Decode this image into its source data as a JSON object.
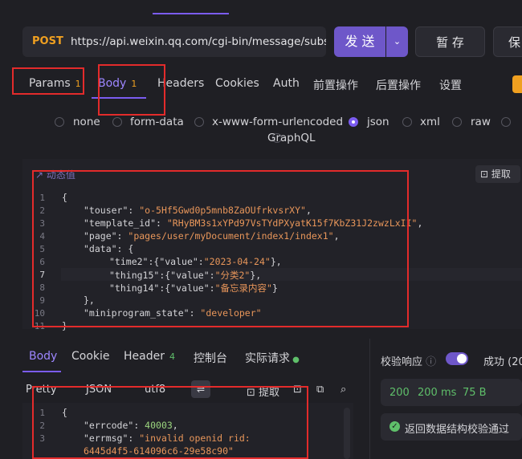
{
  "request": {
    "method": "POST",
    "url": "https://api.weixin.qq.com/cgi-bin/message/subscribe/send",
    "send_label": "发 送",
    "save_label": "暂 存",
    "save2_label": "保"
  },
  "request_tabs": [
    {
      "label": "Params",
      "badge": "1"
    },
    {
      "label": "Body",
      "badge": "1"
    },
    {
      "label": "Headers"
    },
    {
      "label": "Cookies"
    },
    {
      "label": "Auth"
    },
    {
      "label": "前置操作"
    },
    {
      "label": "后置操作"
    },
    {
      "label": "设置"
    }
  ],
  "body_types": [
    "none",
    "form-data",
    "x-www-form-urlencoded",
    "json",
    "xml",
    "raw",
    "GraphQL"
  ],
  "selected_body_type": "json",
  "editor": {
    "dynamic_value_label": "动态值",
    "extract_label": "提取",
    "line_numbers": [
      "1",
      "2",
      "3",
      "4",
      "5",
      "6",
      "7",
      "8",
      "9",
      "10",
      "11"
    ]
  },
  "json_body": {
    "touser_key": "\"touser\"",
    "touser_val": "\"o-5Hf5Gwd0p5mnb8ZaOUfrkvsrXY\"",
    "template_key": "\"template_id\"",
    "template_val": "\"RHyBM3s1xYPd97VsTYdPXyatK15f7KbZ31J2zwzLxII\"",
    "page_key": "\"page\"",
    "page_val": "\"pages/user/myDocument/index1/index1\"",
    "data_key": "\"data\"",
    "time2_key": "\"time2\"",
    "time2_val": "\"2023-04-24\"",
    "thing15_key": "\"thing15\"",
    "thing15_val": "\"分类2\"",
    "thing14_key": "\"thing14\"",
    "thing14_val": "\"备忘录内容\"",
    "value_key": "\"value\"",
    "state_key": "\"miniprogram_state\"",
    "state_val": "\"developer\""
  },
  "response_tabs": [
    {
      "label": "Body"
    },
    {
      "label": "Cookie"
    },
    {
      "label": "Header",
      "badge": "4"
    },
    {
      "label": "控制台"
    },
    {
      "label": "实际请求"
    }
  ],
  "response_toolbar": {
    "format": "Pretty",
    "type": "JSON",
    "encoding": "utf8",
    "extract_label": "提取"
  },
  "response": {
    "line_numbers": [
      "1",
      "2",
      "3"
    ],
    "errcode_key": "\"errcode\"",
    "errcode_val": "40003",
    "errmsg_key": "\"errmsg\"",
    "errmsg_val": "\"invalid openid rid:",
    "errmsg_cont": "6445d4f5-614096c6-29e58c90\""
  },
  "validation": {
    "label": "校验响应",
    "result": "成功 (20",
    "status": "200",
    "time": "200 ms",
    "size": "75 B",
    "pass_text": "返回数据结构校验通过"
  }
}
